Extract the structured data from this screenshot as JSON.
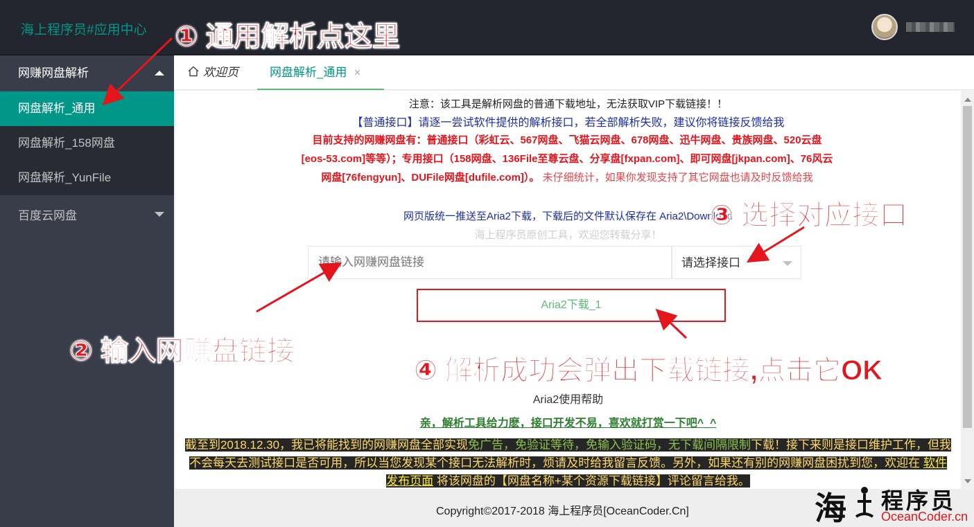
{
  "header": {
    "logo": "海上程序员#应用中心",
    "username": "Mr.Lv"
  },
  "sidebar": {
    "group1": "网赚网盘解析",
    "items": [
      "网盘解析_通用",
      "网盘解析_158网盘",
      "网盘解析_YunFile"
    ],
    "group2": "百度云网盘"
  },
  "tabs": {
    "home": "欢迎页",
    "active": "网盘解析_通用",
    "close": "×"
  },
  "main": {
    "notice": "注意：该工具是解析网盘的普通下载地址，无法获取VIP下载链接！！",
    "blue": "【普通接口】请逐一尝试软件提供的解析接口，若全部解析失败，建议你将链接反馈给我",
    "red_bold": "目前支持的网赚网盘有：普通接口（彩虹云、567网盘、飞猫云网盘、678网盘、迅牛网盘、贵族网盘、520云盘[eos-53.com]等等）；专用接口（158网盘、136File至尊云盘、分享盘[fxpan.com]、即可网盘[jkpan.com]、76风云网盘[76fengyun]、DUFile网盘[dufile.com]）。",
    "red_normal": "未仔细统计，如果你发现支持了其它网盘也请及时反馈给我",
    "aria": "网页版统一推送至Aria2下载，下载后的文件默认保存在 Aria2\\Download",
    "gray": "海上程序员原创工具，欢迎您转载分享！",
    "input_placeholder": "请输入网赚网盘链接",
    "select_value": "请选择接口",
    "button": "Aria2下载_1",
    "help": "Aria2使用帮助",
    "thanks": "亲，解析工具给力麽，接口开发不易，喜欢就打赏一下吧^_^",
    "note_a": "截至到2018.12.30，我已将能找到的网赚网盘全部实现",
    "note_b": "免广告，免验证等待，免输入验证码，无下载间隔限制",
    "note_c": "下载！接下来则是接口维护工作，但我不会每天去测试接口是否可用，所以当您发现某个接口无法解析时，烦请及时给我留言反馈。另外，如果还有别的网赚网盘困扰到您，欢迎在 ",
    "note_link": "软件发布页面",
    "note_d": " 将该网盘的【网盘名称+某个资源下载链接】评论留言给我。"
  },
  "footer": {
    "copyright": "Copyright©2017-2018 海上程序员[OceanCoder.Cn]",
    "brand_cn": "程序员",
    "brand_big": "海",
    "brand_en": "OceanCoder.cn"
  },
  "annotations": {
    "a1": "① 通用解析点这里",
    "a2": "② 输入网赚盘链接",
    "a3": "③ 选择对应接口",
    "a4": "④ 解析成功会弹出下载链接,点击它OK"
  },
  "colors": {
    "accent": "#009688",
    "header_bg": "#23262e",
    "sidebar_bg": "#393d49",
    "annotation": "#e4151c"
  }
}
